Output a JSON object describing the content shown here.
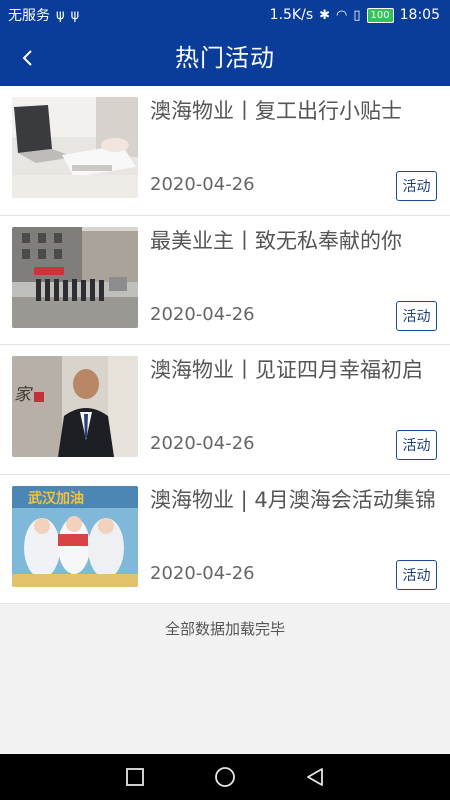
{
  "status_bar": {
    "carrier": "无服务",
    "speed": "1.5K/s",
    "battery": "100",
    "time": "18:05"
  },
  "header": {
    "title": "热门活动",
    "back_icon": "chevron-left-icon"
  },
  "items": [
    {
      "title": "澳海物业丨复工出行小贴士",
      "date": "2020-04-26",
      "tag": "活动"
    },
    {
      "title": "最美业主丨致无私奉献的你",
      "date": "2020-04-26",
      "tag": "活动"
    },
    {
      "title": "澳海物业丨见证四月幸福初启",
      "date": "2020-04-26",
      "tag": "活动"
    },
    {
      "title": "澳海物业 | 4月澳海会活动集锦",
      "date": "2020-04-26",
      "tag": "活动"
    }
  ],
  "footer": {
    "message": "全部数据加载完毕"
  },
  "nav": {
    "recent_icon": "square-icon",
    "home_icon": "circle-icon",
    "back_icon": "triangle-back-icon"
  },
  "colors": {
    "primary": "#0a3c9a",
    "tag_border": "#1d4b96",
    "background": "#f2f2f2"
  }
}
